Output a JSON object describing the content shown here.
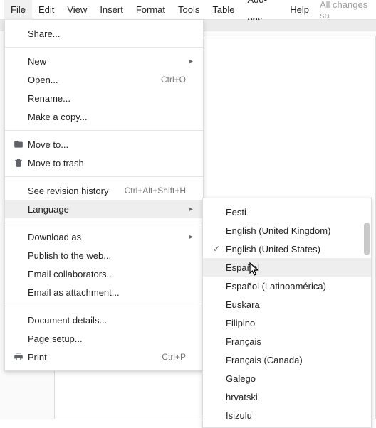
{
  "menubar": {
    "items": [
      "File",
      "Edit",
      "View",
      "Insert",
      "Format",
      "Tools",
      "Table",
      "Add-ons",
      "Help"
    ],
    "active_index": 0,
    "status": "All changes sa"
  },
  "file_menu": {
    "groups": [
      [
        {
          "label": "Share...",
          "icon": "",
          "shortcut": "",
          "submenu": false
        }
      ],
      [
        {
          "label": "New",
          "icon": "",
          "shortcut": "",
          "submenu": true
        },
        {
          "label": "Open...",
          "icon": "",
          "shortcut": "Ctrl+O",
          "submenu": false
        },
        {
          "label": "Rename...",
          "icon": "",
          "shortcut": "",
          "submenu": false
        },
        {
          "label": "Make a copy...",
          "icon": "",
          "shortcut": "",
          "submenu": false
        }
      ],
      [
        {
          "label": "Move to...",
          "icon": "folder",
          "shortcut": "",
          "submenu": false
        },
        {
          "label": "Move to trash",
          "icon": "trash",
          "shortcut": "",
          "submenu": false
        }
      ],
      [
        {
          "label": "See revision history",
          "icon": "",
          "shortcut": "Ctrl+Alt+Shift+H",
          "submenu": false
        },
        {
          "label": "Language",
          "icon": "",
          "shortcut": "",
          "submenu": true,
          "highlight": true
        }
      ],
      [
        {
          "label": "Download as",
          "icon": "",
          "shortcut": "",
          "submenu": true
        },
        {
          "label": "Publish to the web...",
          "icon": "",
          "shortcut": "",
          "submenu": false
        },
        {
          "label": "Email collaborators...",
          "icon": "",
          "shortcut": "",
          "submenu": false
        },
        {
          "label": "Email as attachment...",
          "icon": "",
          "shortcut": "",
          "submenu": false
        }
      ],
      [
        {
          "label": "Document details...",
          "icon": "",
          "shortcut": "",
          "submenu": false
        },
        {
          "label": "Page setup...",
          "icon": "",
          "shortcut": "",
          "submenu": false
        },
        {
          "label": "Print",
          "icon": "print",
          "shortcut": "Ctrl+P",
          "submenu": false
        }
      ]
    ]
  },
  "language_submenu": {
    "items": [
      {
        "label": "Eesti",
        "checked": false,
        "hover": false
      },
      {
        "label": "English (United Kingdom)",
        "checked": false,
        "hover": false
      },
      {
        "label": "English (United States)",
        "checked": true,
        "hover": false
      },
      {
        "label": "Español",
        "checked": false,
        "hover": true
      },
      {
        "label": "Español (Latinoamérica)",
        "checked": false,
        "hover": false
      },
      {
        "label": "Euskara",
        "checked": false,
        "hover": false
      },
      {
        "label": "Filipino",
        "checked": false,
        "hover": false
      },
      {
        "label": "Français",
        "checked": false,
        "hover": false
      },
      {
        "label": "Français (Canada)",
        "checked": false,
        "hover": false
      },
      {
        "label": "Galego",
        "checked": false,
        "hover": false
      },
      {
        "label": "hrvatski",
        "checked": false,
        "hover": false
      },
      {
        "label": "Isizulu",
        "checked": false,
        "hover": false
      }
    ]
  }
}
